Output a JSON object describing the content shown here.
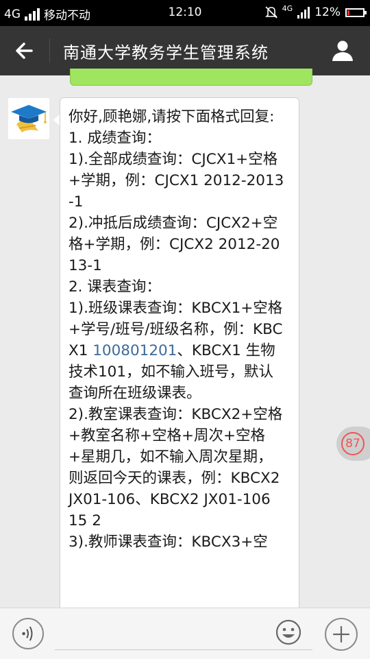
{
  "status_bar": {
    "network": "4G",
    "carrier": "移动不动",
    "time": "12:10",
    "network_small": "4G",
    "battery_text": "12%",
    "battery_level": 0.12
  },
  "header": {
    "title": "南通大学教务学生管理系统"
  },
  "message": {
    "lines": [
      "你好,顾艳娜,请按下面格式回复:",
      "1. 成绩查询：",
      "1).全部成绩查询：CJCX1+空格+学期，例：CJCX1 2012-2013-1",
      "2).冲抵后成绩查询：CJCX2+空格+学期，例：CJCX2 2012-2013-1",
      "2. 课表查询：",
      "1).班级课表查询：KBCX1+空格+学号/班号/班级名称，例：KBCX1 "
    ],
    "link_text": "100801201",
    "after_link": "、KBCX1 生物技术101，如不输入班号，默认查询所在班级课表。",
    "lines2": [
      "2).教室课表查询：KBCX2+空格+教室名称+空格+周次+空格+星期几，如不输入周次星期，则返回今天的课表，例：KBCX2 JX01-106、KBCX2 JX01-106 15 2",
      "3).教师课表查询：KBCX3+空"
    ]
  },
  "unread_badge": "87",
  "icons": {
    "back": "back-arrow-icon",
    "user": "user-icon",
    "voice": "voice-icon",
    "emoji": "emoji-icon",
    "plus": "plus-icon"
  },
  "colors": {
    "titlebar": "#353535",
    "bubble_prev": "#9fe55f",
    "link": "#3e6a9a",
    "badge": "#e55555"
  }
}
